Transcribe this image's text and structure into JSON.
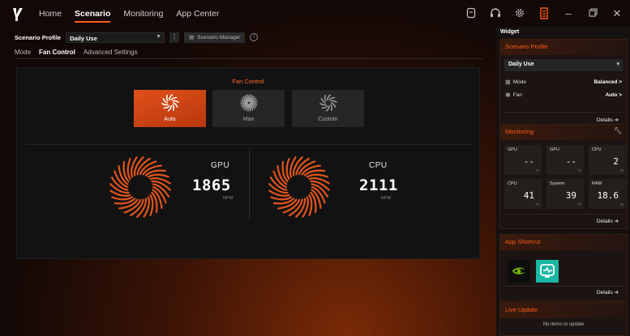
{
  "nav": {
    "tabs": [
      "Home",
      "Scenario",
      "Monitoring",
      "App Center"
    ],
    "active": "Scenario"
  },
  "profile": {
    "label": "Scenario Profile",
    "value": "Daily Use",
    "manager_label": "Scenario Manager"
  },
  "subtabs": [
    "Mode",
    "Fan Control",
    "Advanced Settings"
  ],
  "fan_control": {
    "title": "Fan Control",
    "modes": [
      {
        "label": "Auto",
        "active": true
      },
      {
        "label": "Max",
        "active": false
      },
      {
        "label": "Custom",
        "active": false
      }
    ],
    "gpu": {
      "name": "GPU",
      "value": "1865",
      "unit": "RPM"
    },
    "cpu": {
      "name": "CPU",
      "value": "2111",
      "unit": "RPM"
    }
  },
  "widget": {
    "title": "Widget",
    "scenario": {
      "title": "Scenario Profile",
      "select": "Daily Use",
      "mode_key": "Mode",
      "mode_val": "Balanced >",
      "fan_key": "Fan",
      "fan_val": "Auto >",
      "details": "Details"
    },
    "monitoring": {
      "title": "Monitoring",
      "cells": [
        {
          "name": "GPU",
          "value": "--",
          "unit": "%"
        },
        {
          "name": "GPU",
          "value": "--",
          "unit": "°C"
        },
        {
          "name": "CPU",
          "value": "2",
          "unit": "%"
        },
        {
          "name": "CPU",
          "value": "41",
          "unit": "°C"
        },
        {
          "name": "System",
          "value": "39",
          "unit": "°C"
        },
        {
          "name": "RAM",
          "value": "18.6",
          "unit": "%"
        }
      ],
      "details": "Details"
    },
    "app_shortcut": {
      "title": "App Shortcut",
      "details": "Details"
    },
    "live_update": {
      "title": "Live Update",
      "empty": "No items to update"
    }
  },
  "colors": {
    "accent": "#ff5b14",
    "panel": "#121212"
  }
}
